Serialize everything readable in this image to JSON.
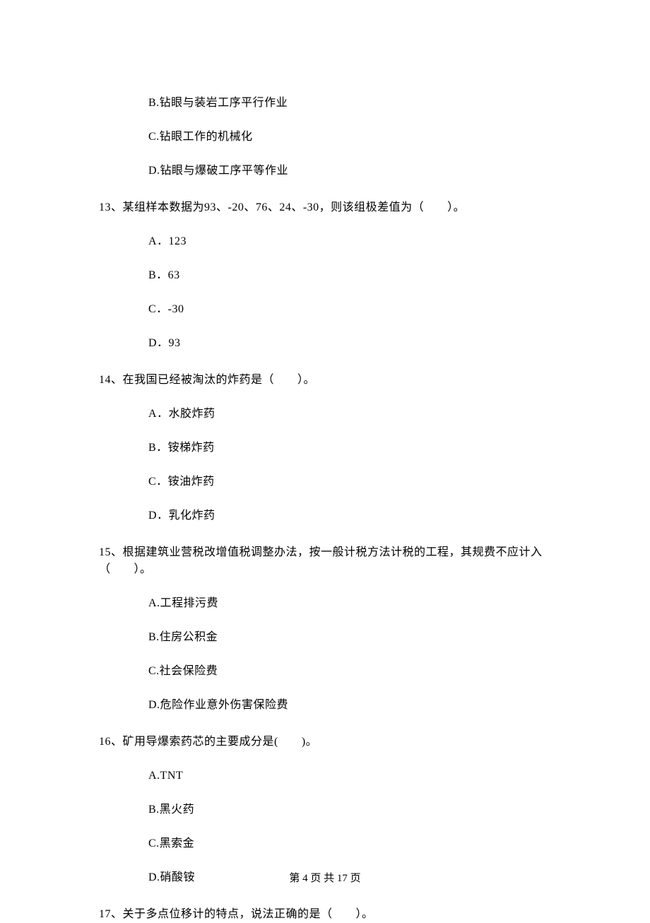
{
  "q12": {
    "options": {
      "B": "B.钻眼与装岩工序平行作业",
      "C": "C.钻眼工作的机械化",
      "D": "D.钻眼与爆破工序平等作业"
    }
  },
  "q13": {
    "stem": "13、某组样本数据为93、-20、76、24、-30，则该组极差值为（　　）。",
    "options": {
      "A": "A．123",
      "B": "B．63",
      "C": "C．-30",
      "D": "D．93"
    }
  },
  "q14": {
    "stem": "14、在我国已经被淘汰的炸药是（　　）。",
    "options": {
      "A": "A．水胶炸药",
      "B": "B．铵梯炸药",
      "C": "C．铵油炸药",
      "D": "D．乳化炸药"
    }
  },
  "q15": {
    "stem": "15、根据建筑业营税改增值税调整办法，按一般计税方法计税的工程，其规费不应计入（　　）。",
    "options": {
      "A": "A.工程排污费",
      "B": "B.住房公积金",
      "C": "C.社会保险费",
      "D": "D.危险作业意外伤害保险费"
    }
  },
  "q16": {
    "stem": "16、矿用导爆索药芯的主要成分是(　　)。",
    "options": {
      "A": "A.TNT",
      "B": "B.黑火药",
      "C": "C.黑索金",
      "D": "D.硝酸铵"
    }
  },
  "q17": {
    "stem": "17、关于多点位移计的特点，说法正确的是（　　）。"
  },
  "footer": "第 4 页 共 17 页"
}
